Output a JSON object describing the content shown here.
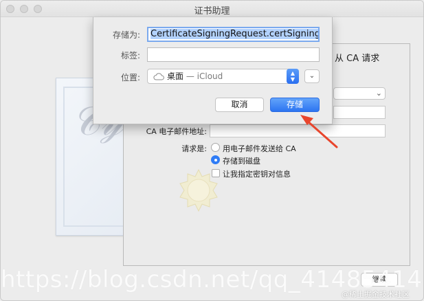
{
  "window": {
    "title": "证书助理"
  },
  "background_form": {
    "partial_heading": "从 CA 请求",
    "ca_email_label": "CA 电子邮件地址:",
    "request_label": "请求是:",
    "options": {
      "email_to_ca": "用电子邮件发送给 CA",
      "save_to_disk": "存储到磁盘",
      "specify_key_pair": "让我指定密钥对信息"
    },
    "selected_option": "save_to_disk",
    "continue_button": "继续"
  },
  "save_sheet": {
    "save_as_label": "存储为:",
    "save_as_value": "CertificateSigningRequest.certSigningRe",
    "tags_label": "标签:",
    "tags_value": "",
    "location_label": "位置:",
    "location_value": "桌面",
    "location_service": "— iCloud",
    "cancel_button": "取消",
    "save_button": "存储"
  },
  "watermarks": {
    "blog_url": "https://blog.csdn.net/qq_41485414",
    "juejin": "@稀土掘金技术社区"
  },
  "colors": {
    "accent": "#2c74f1",
    "arrow": "#e8452c",
    "window_bg": "#ececec"
  },
  "icons": {
    "location": "cloud-icon",
    "stepper": "updown-icon",
    "expand": "chevron-down-icon",
    "seal": "seal-icon"
  }
}
